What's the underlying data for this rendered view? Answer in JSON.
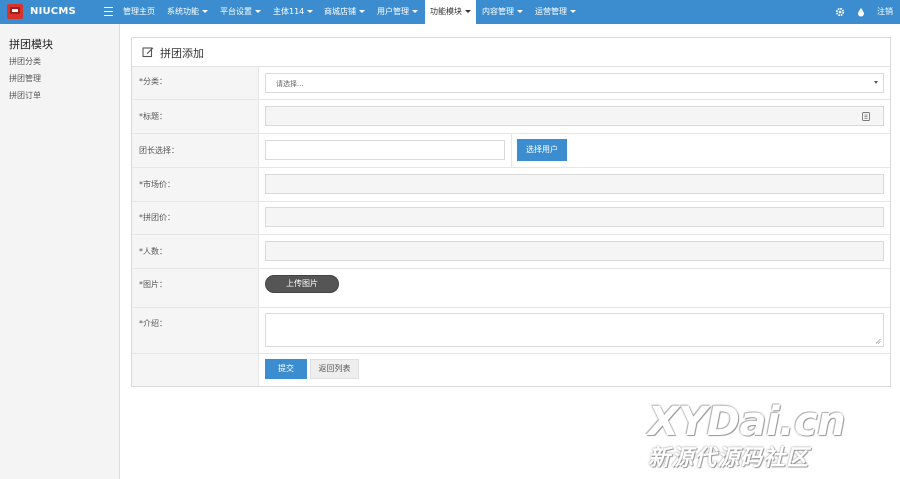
{
  "header": {
    "brand": "NIUCMS",
    "nav": [
      {
        "label": "管理主页",
        "caret": false
      },
      {
        "label": "系统功能",
        "caret": true
      },
      {
        "label": "平台设置",
        "caret": true
      },
      {
        "label": "主体114",
        "caret": true
      },
      {
        "label": "商城店铺",
        "caret": true
      },
      {
        "label": "用户管理",
        "caret": true
      },
      {
        "label": "功能模块",
        "caret": true
      },
      {
        "label": "内容管理",
        "caret": true
      },
      {
        "label": "运营管理",
        "caret": true
      }
    ],
    "logout": "注销",
    "bar_color": "#3c8dcf"
  },
  "sidebar": {
    "title": "拼团模块",
    "items": [
      "拼团分类",
      "拼团管理",
      "拼团订单"
    ]
  },
  "panel": {
    "title": "拼团添加",
    "fields": {
      "category": {
        "label": "*分类：",
        "value": "请选择..."
      },
      "title": {
        "label": "*标题："
      },
      "leader": {
        "label": "团长选择：",
        "button": "选择用户"
      },
      "market_price": {
        "label": "*市场价："
      },
      "group_price": {
        "label": "*拼团价："
      },
      "people": {
        "label": "*人数："
      },
      "image": {
        "label": "*图片：",
        "button": "上传图片"
      },
      "intro": {
        "label": "*介绍："
      }
    },
    "actions": {
      "submit": "提交",
      "back": "返回列表"
    }
  },
  "watermark": {
    "main": "XYDai.cn",
    "sub": "新源代源码社区"
  }
}
